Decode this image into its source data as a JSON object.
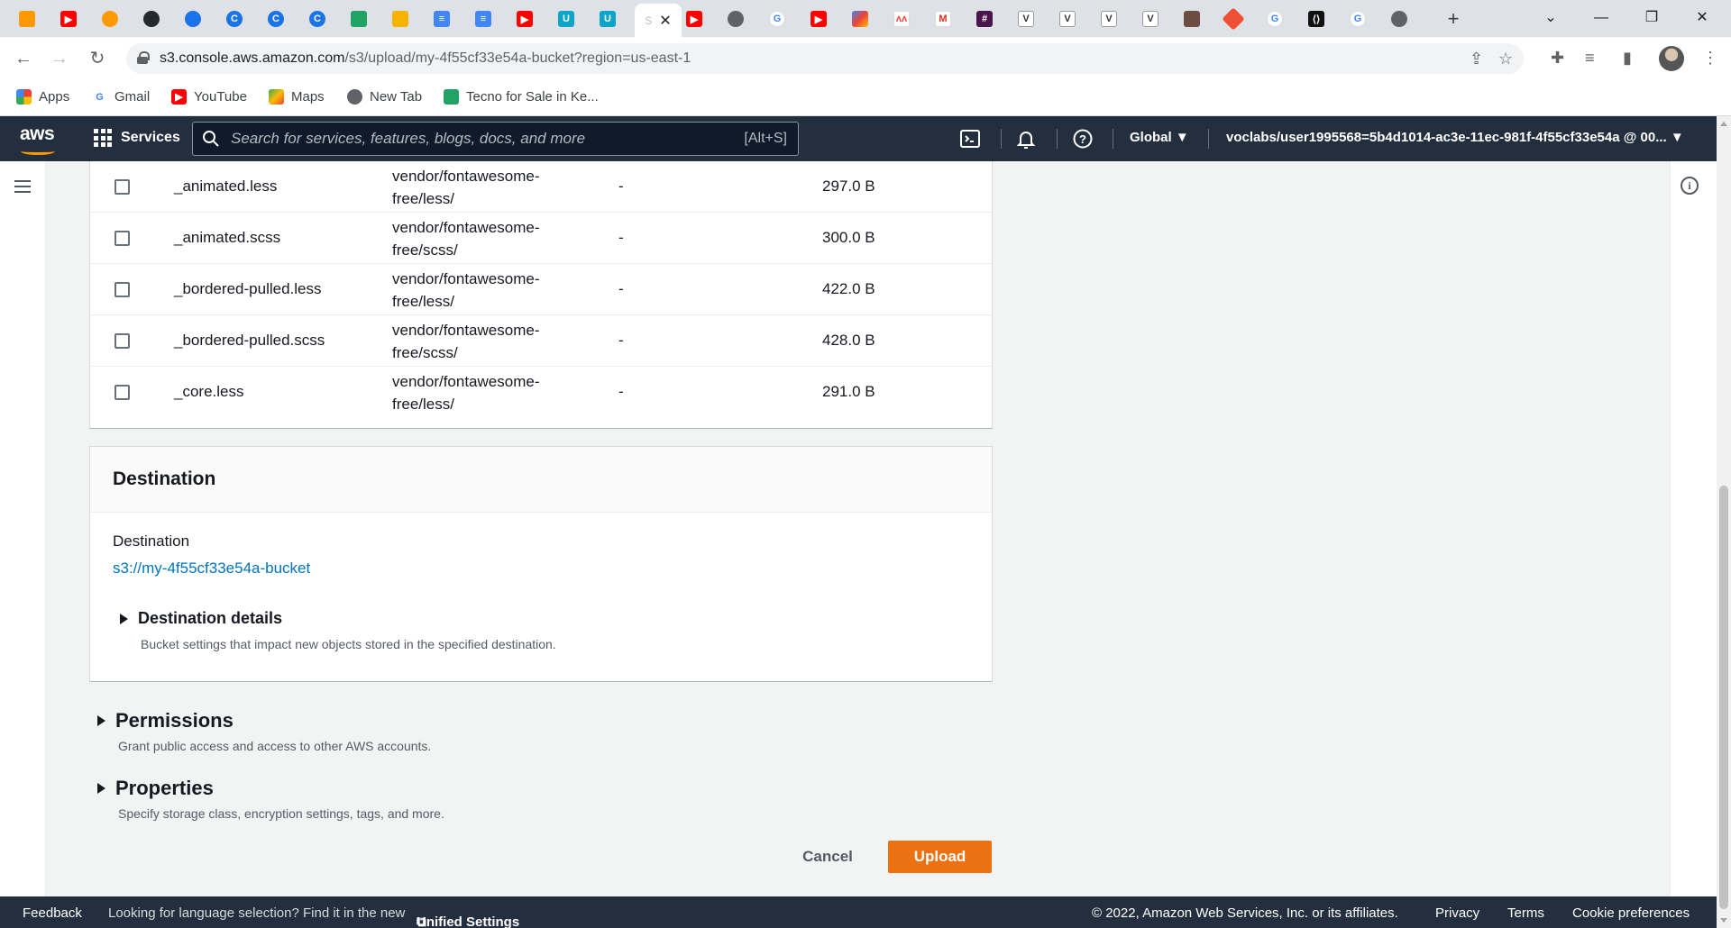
{
  "browser": {
    "active_tab_label": "S",
    "url_host": "s3.console.aws.amazon.com",
    "url_path": "/s3/upload/my-4f55cf33e54a-bucket?region=us-east-1",
    "bookmarks": [
      "Apps",
      "Gmail",
      "YouTube",
      "Maps",
      "New Tab",
      "Tecno for Sale in Ke..."
    ]
  },
  "aws_header": {
    "logo": "aws",
    "services_label": "Services",
    "search_placeholder": "Search for services, features, blogs, docs, and more",
    "search_shortcut": "[Alt+S]",
    "region": "Global",
    "account": "voclabs/user1995568=5b4d1014-ac3e-11ec-981f-4f55cf33e54a @ 00..."
  },
  "files": [
    {
      "name": "_animated.less",
      "folder": "vendor/fontawesome-free/less/",
      "type": "-",
      "size": "297.0 B"
    },
    {
      "name": "_animated.scss",
      "folder": "vendor/fontawesome-free/scss/",
      "type": "-",
      "size": "300.0 B"
    },
    {
      "name": "_bordered-pulled.less",
      "folder": "vendor/fontawesome-free/less/",
      "type": "-",
      "size": "422.0 B"
    },
    {
      "name": "_bordered-pulled.scss",
      "folder": "vendor/fontawesome-free/scss/",
      "type": "-",
      "size": "428.0 B"
    },
    {
      "name": "_core.less",
      "folder": "vendor/fontawesome-free/less/",
      "type": "-",
      "size": "291.0 B"
    }
  ],
  "destination": {
    "heading": "Destination",
    "label": "Destination",
    "bucket_uri": "s3://my-4f55cf33e54a-bucket",
    "details_title": "Destination details",
    "details_desc": "Bucket settings that impact new objects stored in the specified destination."
  },
  "permissions": {
    "title": "Permissions",
    "desc": "Grant public access and access to other AWS accounts."
  },
  "properties": {
    "title": "Properties",
    "desc": "Specify storage class, encryption settings, tags, and more."
  },
  "actions": {
    "cancel": "Cancel",
    "upload": "Upload"
  },
  "footer": {
    "feedback": "Feedback",
    "language_prompt": "Looking for language selection? Find it in the new",
    "unified_settings": "Unified Settings",
    "copyright": "© 2022, Amazon Web Services, Inc. or its affiliates.",
    "privacy": "Privacy",
    "terms": "Terms",
    "cookie": "Cookie preferences"
  },
  "colors": {
    "aws_nav": "#232f3e",
    "aws_orange": "#ec7211",
    "link_blue": "#0073bb"
  }
}
